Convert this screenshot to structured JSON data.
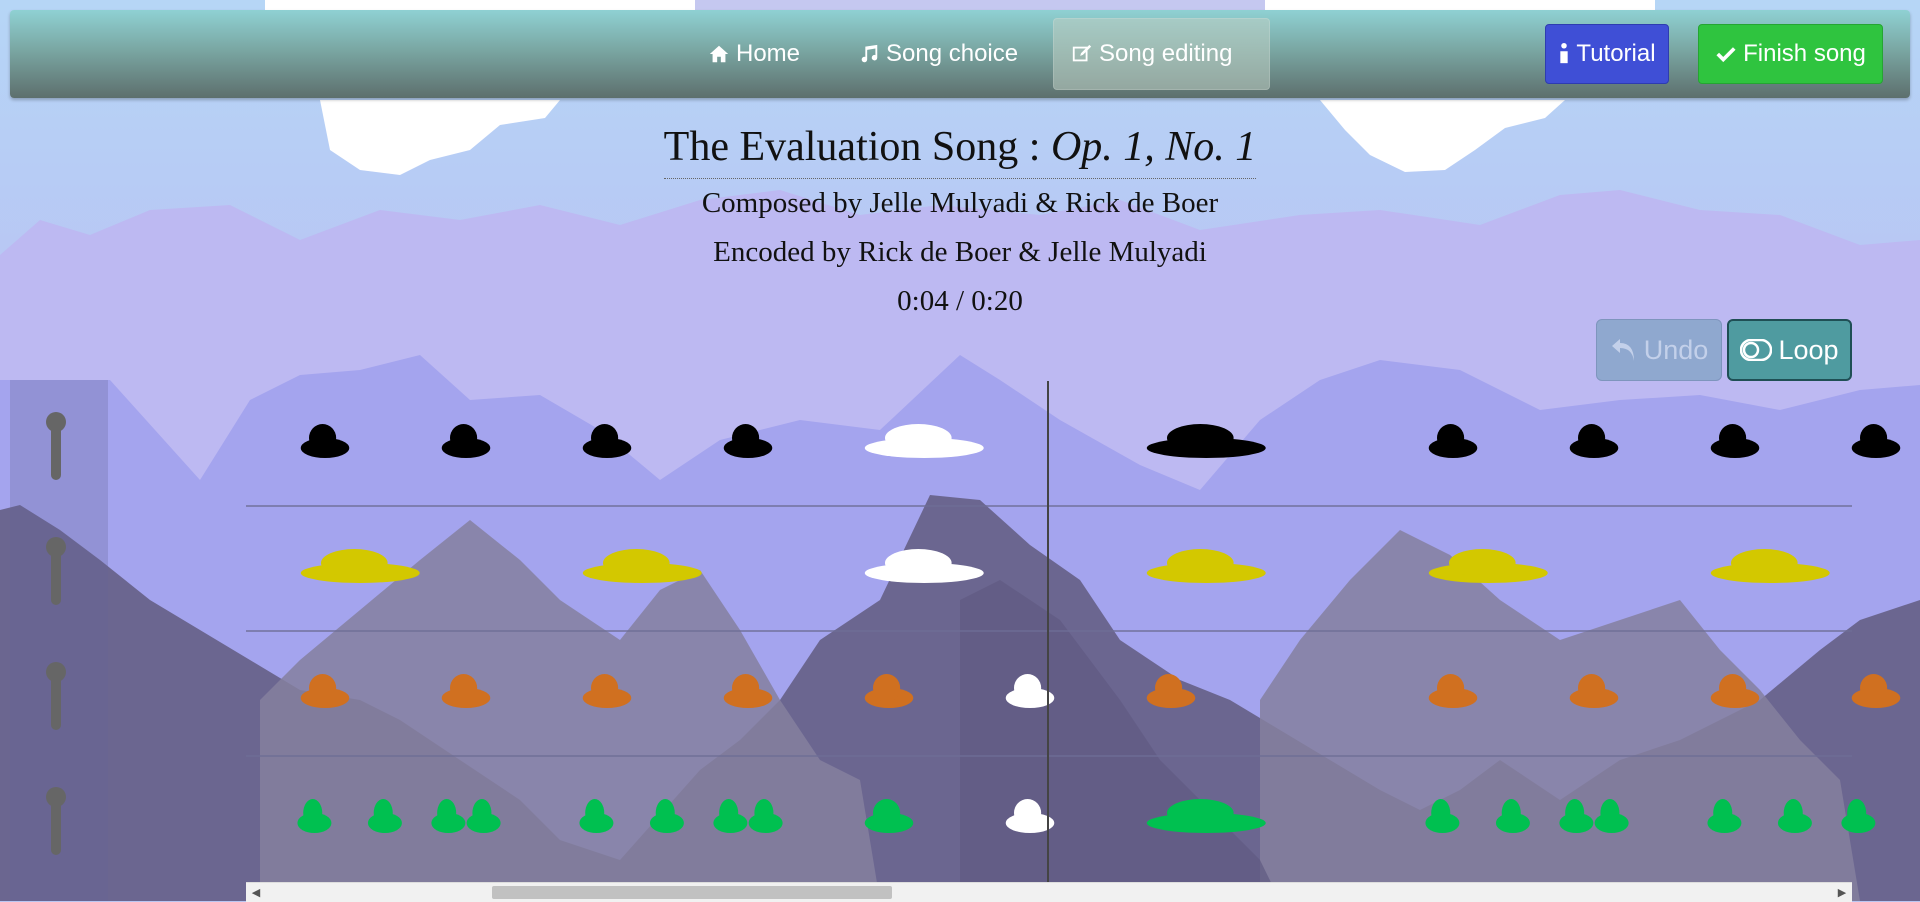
{
  "nav": {
    "home_label": "Home",
    "song_choice_label": "Song choice",
    "song_editing_label": "Song editing",
    "tutorial_label": "Tutorial",
    "finish_label": "Finish song"
  },
  "song": {
    "title": "The Evaluation Song : ",
    "opus": "Op. 1, No. 1",
    "composed": "Composed by Jelle Mulyadi & Rick de Boer",
    "encoded": "Encoded by Rick de Boer & Jelle Mulyadi",
    "time": "0:04 / 0:20"
  },
  "controls": {
    "undo_label": "Undo",
    "loop_label": "Loop"
  },
  "colors": {
    "track_1": "#000000",
    "track_2": "#d3c800",
    "track_3": "#d07020",
    "track_4": "#00c050",
    "playing": "#ffffff",
    "tutorial": "#3f4fd6",
    "finish": "#2fc43f"
  },
  "tracks": [
    {
      "name": "track-1",
      "notes": [
        [
          0,
          1
        ],
        [
          2,
          1
        ],
        [
          4,
          1
        ],
        [
          6,
          1
        ],
        [
          8,
          2,
          "playing"
        ],
        [
          12,
          2
        ],
        [
          16,
          1
        ],
        [
          18,
          1
        ],
        [
          20,
          1
        ],
        [
          22,
          1
        ]
      ]
    },
    {
      "name": "track-2",
      "notes": [
        [
          0,
          2
        ],
        [
          4,
          2
        ],
        [
          8,
          2,
          "playing"
        ],
        [
          12,
          2
        ],
        [
          16,
          2
        ],
        [
          20,
          2
        ]
      ]
    },
    {
      "name": "track-3",
      "notes": [
        [
          0,
          1
        ],
        [
          2,
          1
        ],
        [
          4,
          1
        ],
        [
          6,
          1
        ],
        [
          8,
          1
        ],
        [
          10,
          1,
          "playing"
        ],
        [
          12,
          1
        ],
        [
          16,
          1
        ],
        [
          18,
          1
        ],
        [
          20,
          1
        ],
        [
          22,
          1
        ]
      ]
    },
    {
      "name": "track-4",
      "notes": [
        [
          0,
          0.7
        ],
        [
          1,
          0.7
        ],
        [
          2,
          0.5
        ],
        [
          2.5,
          0.5
        ],
        [
          4,
          0.7
        ],
        [
          5,
          0.7
        ],
        [
          6,
          0.5
        ],
        [
          6.5,
          0.5
        ],
        [
          8,
          1
        ],
        [
          10,
          1,
          "playing"
        ],
        [
          12,
          2
        ],
        [
          16,
          0.7
        ],
        [
          17,
          0.7
        ],
        [
          18,
          0.5
        ],
        [
          18.5,
          0.5
        ],
        [
          20,
          0.7
        ],
        [
          21,
          0.7
        ],
        [
          22,
          0.5
        ]
      ]
    }
  ]
}
